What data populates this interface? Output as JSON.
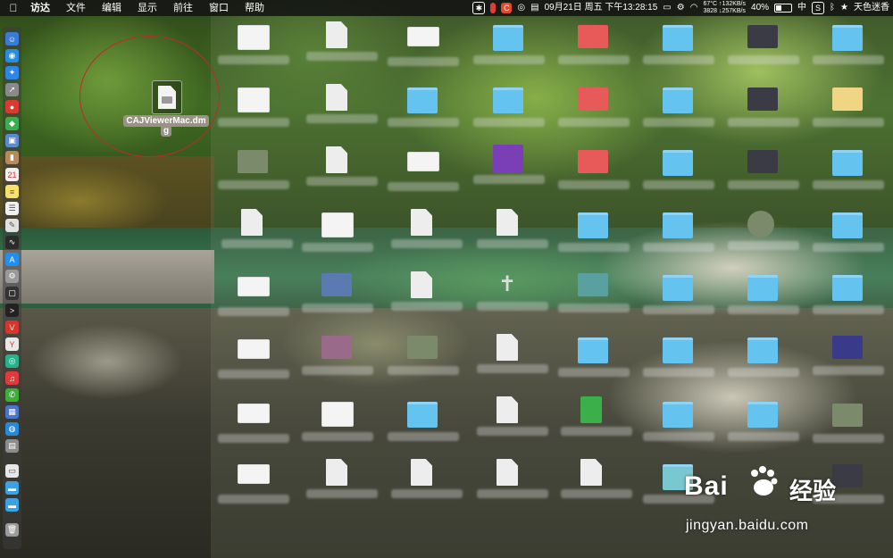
{
  "menubar": {
    "apple_icon": "apple-icon",
    "app_name": "访达",
    "menus": [
      "文件",
      "编辑",
      "显示",
      "前往",
      "窗口",
      "帮助"
    ],
    "status": {
      "clock": "09月21日 周五 下午13:28:15",
      "temp_net_top": "67°C ↑132KB/s",
      "temp_net_bottom": "3828 ↓257KB/s",
      "battery_percent": "40%",
      "battery_level": 0.4,
      "input_method": "中",
      "user_name": "天色迷香"
    }
  },
  "desktop": {
    "selected_file": {
      "name_line1": "CAJViewerMac.dm",
      "name_line2": "g",
      "icon": "disk-image-icon"
    }
  },
  "watermark": {
    "logo": "Bai",
    "logo_suffix": "经验",
    "url": "jingyan.baidu.com"
  },
  "colors": {
    "menubar_bg": "#141414",
    "folder": "#65c3f0",
    "highlight_circle": "#c0292b",
    "selection_label_bg": "#9a9286"
  }
}
